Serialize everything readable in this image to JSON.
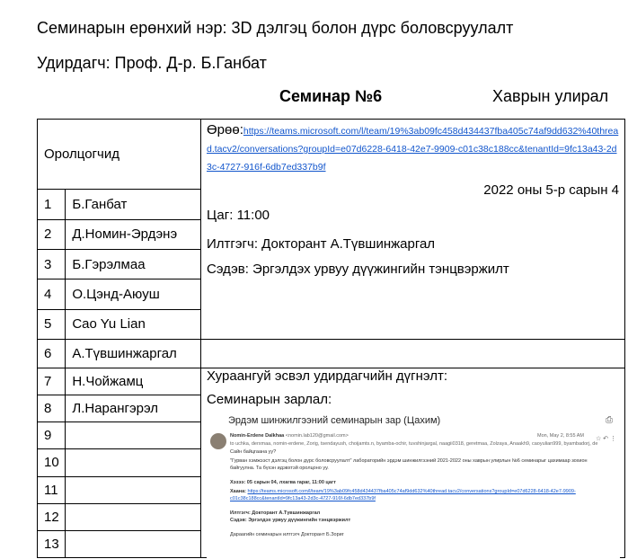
{
  "header": {
    "title": "Семинарын ерөнхий нэр: 3D дэлгэц болон дүрс боловсруулалт",
    "lead": "Удирдагч: Проф. Д-р. Б.Ганбат",
    "seminar": "Семинар  №6",
    "semester": "Хаврын улирал"
  },
  "participants_label": "Оролцогчид",
  "participants": [
    {
      "n": "1",
      "name": "Б.Ганбат"
    },
    {
      "n": "2",
      "name": "Д.Номин-Эрдэнэ"
    },
    {
      "n": "3",
      "name": "Б.Гэрэлмаа"
    },
    {
      "n": "4",
      "name": "О.Цэнд-Аюуш"
    },
    {
      "n": "5",
      "name": "Cao Yu Lian"
    },
    {
      "n": "6",
      "name": "А.Түвшинжаргал"
    },
    {
      "n": "7",
      "name": "Н.Чойжамц"
    },
    {
      "n": "8",
      "name": "Л.Нарангэрэл"
    },
    {
      "n": "9",
      "name": ""
    },
    {
      "n": "10",
      "name": ""
    },
    {
      "n": "11",
      "name": ""
    },
    {
      "n": "12",
      "name": ""
    },
    {
      "n": "13",
      "name": ""
    }
  ],
  "room": {
    "label": "Өрөө:",
    "link": "https://teams.microsoft.com/l/team/19%3ab09fc458d434437fba405c74af9dd632%40thread.tacv2/conversations?groupId=e07d6228-6418-42e7-9909-c01c38c188cc&tenantId=9fc13a43-2d3c-4727-916f-6db7ed337b9f"
  },
  "date": "2022 оны 5-р сарын 4",
  "time": "Цаг:  11:00",
  "presenter": "Илтгэгч:    Докторант А.Түвшинжаргал",
  "topic": "Сэдэв:    Эргэлдэх урвуу дүүжингийн тэнцвэржилт",
  "summary_label": "Хураангуй эсвэл удирдагчийн дүгнэлт:",
  "announce_label": "Семинарын зарлал:",
  "email": {
    "subject": "Эрдэм шинжилгээний семинарын зар (Цахим)",
    "sender": "Nomin-Erdene Dalkhaa",
    "sender_addr": "<nomin.lab120@gmail.com>",
    "recipients": "to uchka, derxmaa, nomin-erdene, Zorig, tsendayush, choijamts.n, byamba-ochir, tuvshinjargal, naagii0318, geretmaa, Zolzaya, Anaakh9, caoyulian999, byambadorj, de",
    "date": "Mon, May 2, 8:55 AM",
    "greeting": "Сайн байцгаана уу?",
    "body": "\"Гурван хэмжээст дэлгэц болон дүрс боловсруулалт\" лабораторийн эрдэм шинжилгээний 2021-2022 оны хаврын улирлын №6 семинарыг цахимаар зохион байгуулна. Та бүхэн идэвхтэй оролцоно уу.",
    "when": "Хэзээ: 05 сарын 04, лхагва гараг, 11:00 цагт",
    "where_label": "Хаана:",
    "where_link": "https://teams.microsoft.com/l/team/19%3ab09fc458d434437fba405c74af9dd632%40thread.tacv2/conversations?groupId=e07d6228-6418-42e7-9909-c01c38c188cc&tenantId=9fc13a43-2d3c-4727-916f-6db7ed337b9f",
    "presenter": "Илтгэгч: Докторант А.Түвшинжаргал",
    "topic": "Сэдэв: Эргэлдэх урвуу дүүжингийн тэнцвэржилт",
    "footer": "Дараагийн семинарын илтгэгч Докторант Б.Зориг"
  }
}
